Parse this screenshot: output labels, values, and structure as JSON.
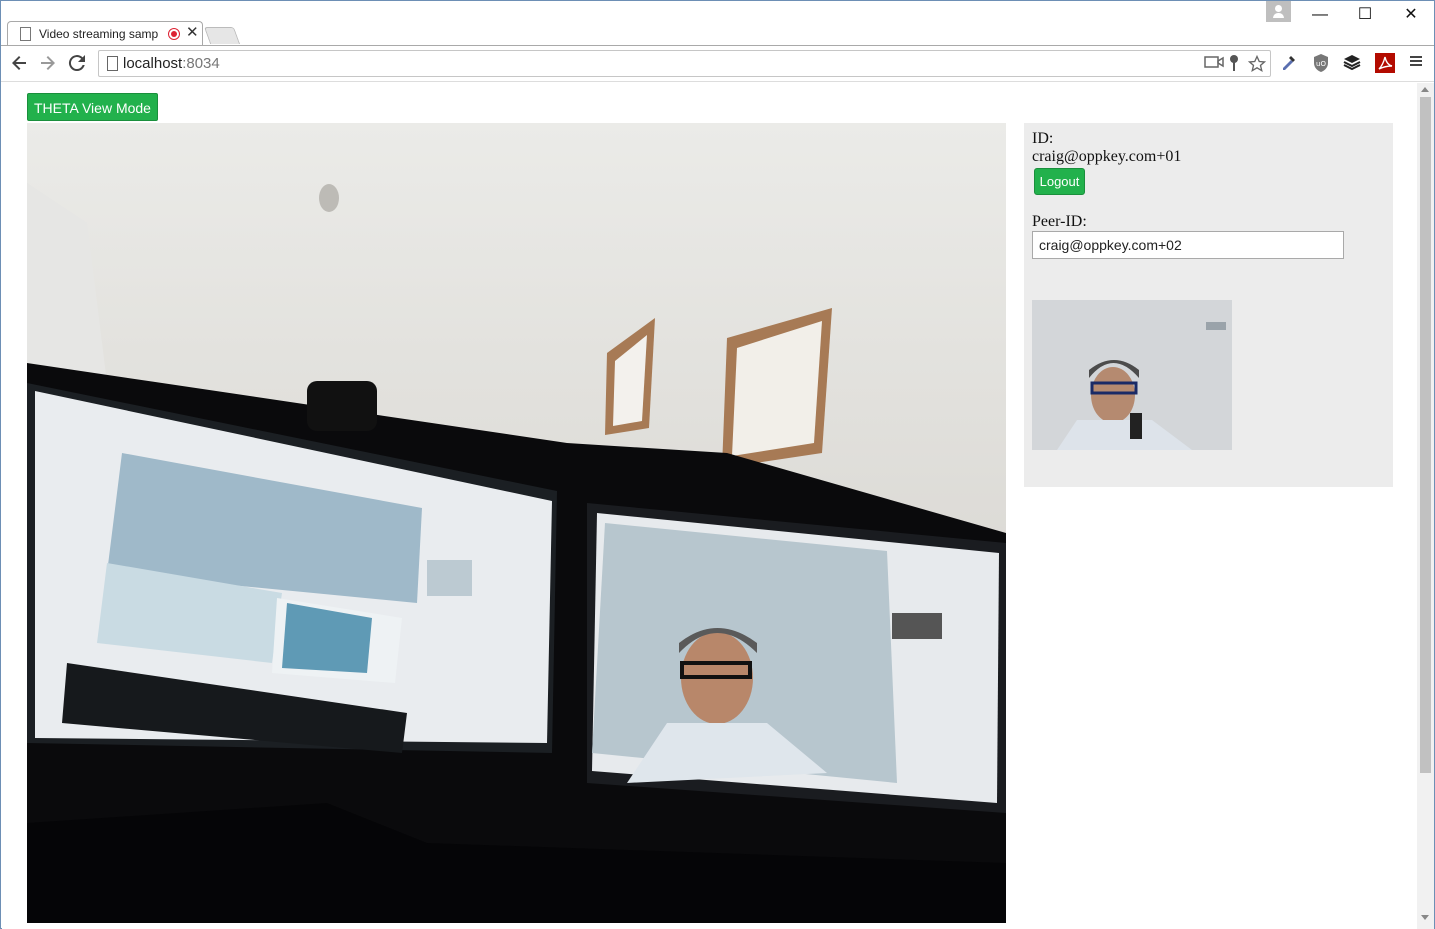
{
  "browser": {
    "tab_title": "Video streaming samp",
    "url_host": "localhost",
    "url_port": ":8034",
    "window_controls": {
      "minimize": "—",
      "maximize": "☐",
      "close": "✕"
    }
  },
  "toolbar": {
    "back_icon": "back-arrow-icon",
    "forward_icon": "forward-arrow-icon",
    "reload_icon": "reload-icon"
  },
  "page": {
    "theta_button_label": "THETA View Mode",
    "id_label": "ID:",
    "id_value": "craig@oppkey.com+01",
    "logout_label": "Logout",
    "peer_id_label": "Peer-ID:",
    "peer_id_value": "craig@oppkey.com+02"
  },
  "colors": {
    "button_green": "#22b14c",
    "panel_bg": "#ececec"
  }
}
